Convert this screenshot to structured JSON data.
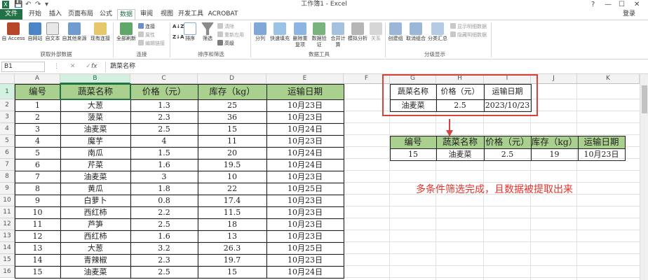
{
  "window": {
    "title": "工作簿1 - Excel",
    "help_glyph": "?",
    "controls": [
      "—",
      "☐",
      "✕"
    ],
    "qat": [
      "X",
      "💾",
      "↶",
      "↷",
      "▾"
    ]
  },
  "tabs": [
    "文件",
    "开始",
    "插入",
    "页面布局",
    "公式",
    "数据",
    "审阅",
    "视图",
    "开发工具",
    "ACROBAT"
  ],
  "active_tab": "数据",
  "login_label": "登录",
  "ribbon": {
    "groups": [
      {
        "label": "获取外部数据",
        "buttons": [
          "自 Access",
          "自网站",
          "自文本",
          "自其他来源",
          "现有连接"
        ]
      },
      {
        "label": "连接",
        "buttons": [
          "全部刷新"
        ],
        "small": [
          "连接",
          "属性",
          "编辑链接"
        ]
      },
      {
        "label": "排序和筛选",
        "buttons": [
          "排序",
          "筛选"
        ],
        "small": [
          "清除",
          "重新应用",
          "高级"
        ]
      },
      {
        "label": "数据工具",
        "buttons": [
          "分列",
          "快速填充",
          "删除重复项",
          "数据验证",
          "合并计算",
          "模拟分析",
          "关系"
        ]
      },
      {
        "label": "分级显示",
        "buttons": [
          "创建组",
          "取消组合",
          "分类汇总"
        ],
        "small": [
          "显示明细数据",
          "隐藏明细数据"
        ]
      }
    ],
    "small_az": "A↓Z",
    "small_za": "Z↓A"
  },
  "formula_bar": {
    "name_box": "B1",
    "buttons": "⋮ ✕ ✓",
    "fx": "fx",
    "content": "蔬菜名称"
  },
  "columns": [
    "A",
    "B",
    "C",
    "D",
    "E",
    "F",
    "G",
    "H",
    "I",
    "J",
    "K"
  ],
  "selected_column": "B",
  "rows": [
    "1",
    "2",
    "3",
    "4",
    "5",
    "6",
    "7",
    "8",
    "9",
    "10",
    "11",
    "12",
    "13",
    "14",
    "15",
    "16"
  ],
  "main_table": {
    "headers": [
      "编号",
      "蔬菜名称",
      "价格（元）",
      "库存（kg）",
      "运输日期"
    ],
    "rows": [
      [
        "1",
        "大葱",
        "1.3",
        "25",
        "10月23日"
      ],
      [
        "2",
        "菠菜",
        "2.3",
        "36",
        "10月23日"
      ],
      [
        "3",
        "油麦菜",
        "2.5",
        "15",
        "10月24日"
      ],
      [
        "4",
        "魔芋",
        "4",
        "11",
        "10月23日"
      ],
      [
        "5",
        "南瓜",
        "1.5",
        "20",
        "10月24日"
      ],
      [
        "6",
        "芹菜",
        "1.6",
        "19.5",
        "10月24日"
      ],
      [
        "7",
        "油麦菜",
        "3",
        "10",
        "10月23日"
      ],
      [
        "8",
        "黄瓜",
        "1.8",
        "22",
        "10月25日"
      ],
      [
        "9",
        "白萝卜",
        "0.8",
        "17.4",
        "10月23日"
      ],
      [
        "10",
        "西红柿",
        "2.2",
        "11.5",
        "10月23日"
      ],
      [
        "11",
        "芦笋",
        "2.5",
        "18",
        "10月23日"
      ],
      [
        "12",
        "西红柿",
        "1.6",
        "13",
        "10月23日"
      ],
      [
        "13",
        "大葱",
        "3.2",
        "26.3",
        "10月25日"
      ],
      [
        "14",
        "青辣椒",
        "2.3",
        "19.7",
        "10月23日"
      ],
      [
        "15",
        "油麦菜",
        "2.5",
        "15",
        "10月24日"
      ]
    ]
  },
  "criteria_table": {
    "headers": [
      "蔬菜名称",
      "价格（元）",
      "运输日期"
    ],
    "row": [
      "油麦菜",
      "2.5",
      "2023/10/23"
    ]
  },
  "result_table": {
    "headers": [
      "编号",
      "蔬菜名称",
      "价格（元）",
      "库存（kg）",
      "运输日期"
    ],
    "row": [
      "15",
      "油麦菜",
      "2.5",
      "19",
      "10月23日"
    ]
  },
  "annotation": "多条件筛选完成，且数据被提取出来",
  "colors": {
    "header_fill": "#a9d08e",
    "excel_green": "#217346",
    "highlight_red": "#d9413d",
    "annotation_red": "#e8302a"
  }
}
